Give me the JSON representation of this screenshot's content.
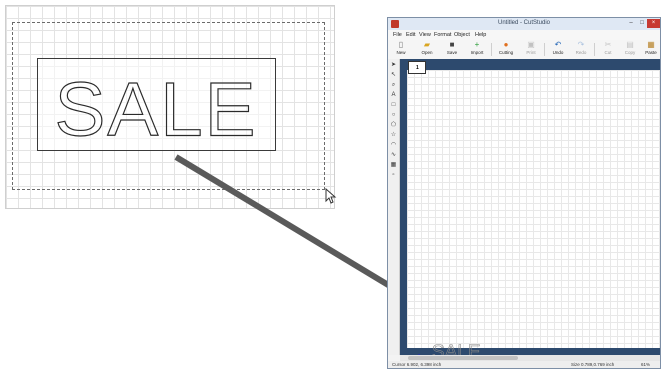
{
  "zoom_panel": {
    "word": "SALE"
  },
  "window": {
    "title": "Untitled - CutStudio",
    "menu": [
      "File",
      "Edit",
      "View",
      "Format",
      "Object",
      "Help"
    ],
    "toolbar": [
      {
        "label": "New",
        "icon": "new-document-icon",
        "disabled": false
      },
      {
        "label": "Open",
        "icon": "open-folder-icon",
        "disabled": false
      },
      {
        "label": "Save",
        "icon": "save-disk-icon",
        "disabled": false
      },
      {
        "label": "Import",
        "icon": "import-plus-icon",
        "disabled": false
      },
      {
        "label": "Cutting",
        "icon": "cutting-icon",
        "disabled": false
      },
      {
        "label": "Print",
        "icon": "print-icon",
        "disabled": true
      },
      {
        "label": "Undo",
        "icon": "undo-icon",
        "disabled": false
      },
      {
        "label": "Redo",
        "icon": "redo-icon",
        "disabled": true
      },
      {
        "label": "Cut",
        "icon": "cut-icon",
        "disabled": true
      },
      {
        "label": "Copy",
        "icon": "copy-icon",
        "disabled": true
      },
      {
        "label": "Paste",
        "icon": "paste-icon",
        "disabled": false
      }
    ],
    "page_number": "1",
    "canvas_word": "SALE",
    "status": {
      "cursor": "Cursor 6.902, 6.398 inch",
      "size": "Size 0.789,0.769 inch",
      "zoom": "61%"
    }
  }
}
